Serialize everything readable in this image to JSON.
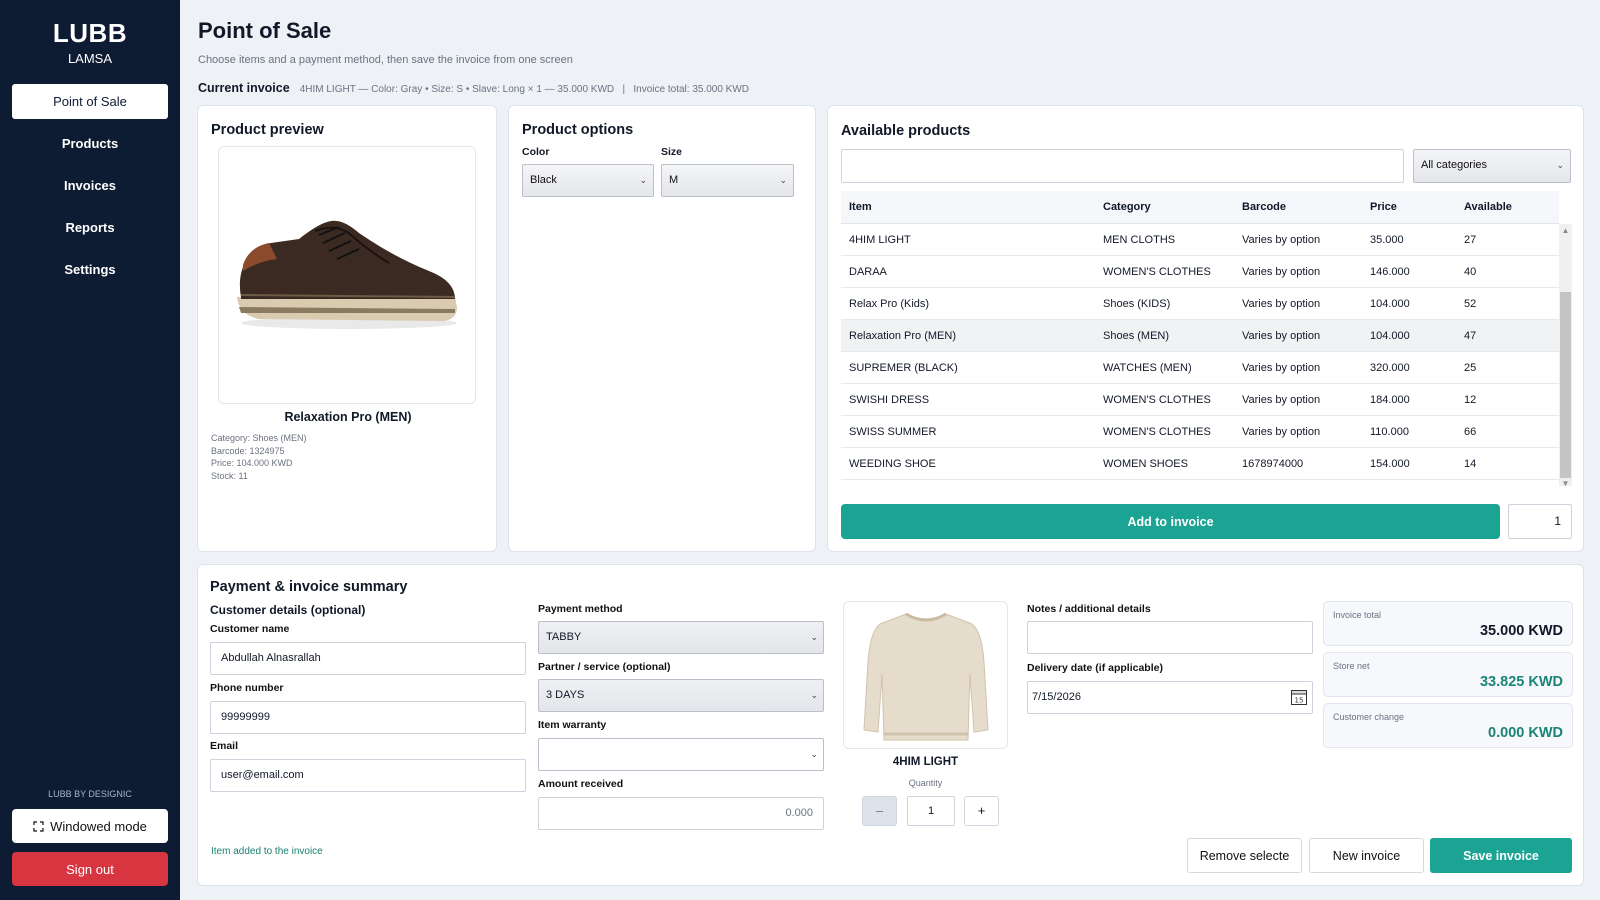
{
  "sidebar": {
    "brand_name": "LUBB",
    "brand_sub": "LAMSA",
    "items": [
      {
        "label": "Point of Sale"
      },
      {
        "label": "Products"
      },
      {
        "label": "Invoices"
      },
      {
        "label": "Reports"
      },
      {
        "label": "Settings"
      }
    ],
    "credit": "LUBB BY DESIGNIC",
    "windowed_label": "Windowed mode",
    "signout_label": "Sign out"
  },
  "header": {
    "title": "Point of Sale",
    "subtitle": "Choose items and a payment method, then save the invoice from one screen",
    "current_invoice_label": "Current invoice",
    "current_invoice_detail": "4HIM LIGHT — Color: Gray • Size: S • Slave: Long × 1 — 35.000 KWD   |   Invoice total: 35.000 KWD"
  },
  "preview": {
    "title": "Product preview",
    "name": "Relaxation Pro (MEN)",
    "category": "Category: Shoes (MEN)",
    "barcode": "Barcode: 1324975",
    "price": "Price: 104.000 KWD",
    "stock": "Stock: 11"
  },
  "options": {
    "title": "Product options",
    "color_label": "Color",
    "color_value": "Black",
    "size_label": "Size",
    "size_value": "M"
  },
  "products": {
    "title": "Available products",
    "search_value": "",
    "category_value": "All categories",
    "columns": [
      "Item",
      "Category",
      "Barcode",
      "Price",
      "Available"
    ],
    "rows": [
      [
        "4HIM LIGHT",
        "MEN CLOTHS",
        "Varies by option",
        "35.000",
        "27"
      ],
      [
        "DARAA",
        "WOMEN'S CLOTHES",
        "Varies by option",
        "146.000",
        "40"
      ],
      [
        "Relax Pro (Kids)",
        "Shoes (KIDS)",
        "Varies by option",
        "104.000",
        "52"
      ],
      [
        "Relaxation Pro (MEN)",
        "Shoes (MEN)",
        "Varies by option",
        "104.000",
        "47"
      ],
      [
        "SUPREMER (BLACK)",
        "WATCHES (MEN)",
        "Varies by option",
        "320.000",
        "25"
      ],
      [
        "SWISHI DRESS",
        "WOMEN'S CLOTHES",
        "Varies by option",
        "184.000",
        "12"
      ],
      [
        "SWISS SUMMER",
        "WOMEN'S CLOTHES",
        "Varies by option",
        "110.000",
        "66"
      ],
      [
        "WEEDING SHOE",
        "WOMEN SHOES",
        "1678974000",
        "154.000",
        "14"
      ]
    ],
    "selected_row": 3,
    "add_label": "Add to invoice",
    "qty": "1"
  },
  "payment": {
    "title": "Payment & invoice summary",
    "customer_section": "Customer details (optional)",
    "customer_name_label": "Customer name",
    "customer_name": "Abdullah Alnasrallah",
    "phone_label": "Phone number",
    "phone": "99999999",
    "email_label": "Email",
    "email": "user@email.com",
    "method_label": "Payment method",
    "method": "TABBY",
    "partner_label": "Partner / service (optional)",
    "partner": "3 DAYS",
    "warranty_label": "Item warranty",
    "warranty": "",
    "amount_label": "Amount received",
    "amount": "0.000",
    "status": "Item added to the invoice",
    "item_name": "4HIM LIGHT",
    "qty_label": "Quantity",
    "qty": "1",
    "minus": "–",
    "plus": "+",
    "notes_label": "Notes / additional details",
    "notes": "",
    "delivery_label": "Delivery date (if applicable)",
    "delivery": "7/15/2026",
    "calendar_day": "15",
    "totals": [
      {
        "label": "Invoice total",
        "value": "35.000 KWD"
      },
      {
        "label": "Store net",
        "value": "33.825 KWD"
      },
      {
        "label": "Customer change",
        "value": "0.000 KWD"
      }
    ],
    "remove_label": "Remove selecte",
    "new_label": "New invoice",
    "save_label": "Save invoice"
  },
  "colors": {
    "sidebar_bg": "#0d1b33",
    "accent": "#1ba394",
    "danger": "#d73540",
    "positive": "#1a8577"
  }
}
